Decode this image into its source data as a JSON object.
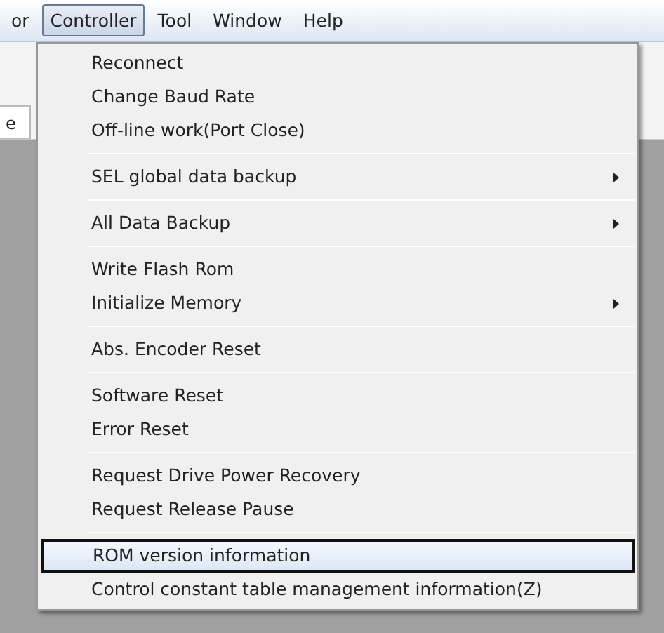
{
  "menu_bar": [
    {
      "label": "or",
      "selected": false
    },
    {
      "label": "Controller",
      "selected": true
    },
    {
      "label": "Tool",
      "selected": false
    },
    {
      "label": "Window",
      "selected": false
    },
    {
      "label": "Help",
      "selected": false
    }
  ],
  "background_tab": {
    "label": "e"
  },
  "dropdown": {
    "groups": [
      [
        {
          "label": "Reconnect",
          "submenu": false,
          "selected": false
        },
        {
          "label": "Change Baud Rate",
          "submenu": false,
          "selected": false
        },
        {
          "label": "Off-line work(Port Close)",
          "submenu": false,
          "selected": false
        }
      ],
      [
        {
          "label": "SEL global data backup",
          "submenu": true,
          "selected": false
        }
      ],
      [
        {
          "label": "All Data Backup",
          "submenu": true,
          "selected": false
        }
      ],
      [
        {
          "label": "Write Flash Rom",
          "submenu": false,
          "selected": false
        },
        {
          "label": "Initialize Memory",
          "submenu": true,
          "selected": false
        }
      ],
      [
        {
          "label": "Abs. Encoder Reset",
          "submenu": false,
          "selected": false
        }
      ],
      [
        {
          "label": "Software Reset",
          "submenu": false,
          "selected": false
        },
        {
          "label": "Error Reset",
          "submenu": false,
          "selected": false
        }
      ],
      [
        {
          "label": "Request Drive Power Recovery",
          "submenu": false,
          "selected": false
        },
        {
          "label": "Request Release Pause",
          "submenu": false,
          "selected": false
        }
      ],
      [
        {
          "label": "ROM version information",
          "submenu": false,
          "selected": true
        },
        {
          "label": "Control constant table management information(Z)",
          "submenu": false,
          "selected": false
        }
      ]
    ]
  }
}
